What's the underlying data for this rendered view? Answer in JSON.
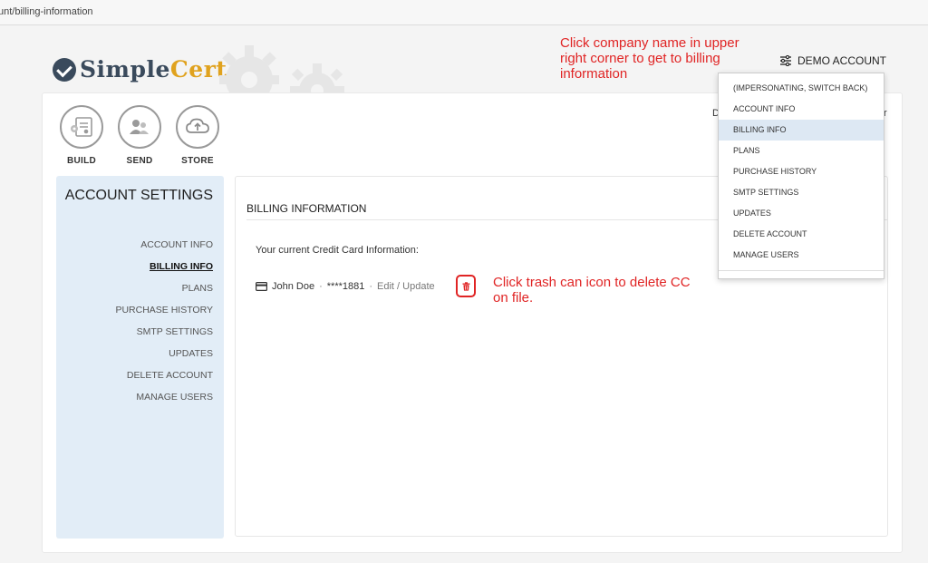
{
  "browser": {
    "url_fragment": "unt/billing-information"
  },
  "brand": {
    "name_part1": "Simple",
    "name_part2": "Cert"
  },
  "annotations": {
    "top": "Click company name in upper right corner to get to billing information",
    "cc": "Click trash can icon to delete CC on file."
  },
  "account_menu": {
    "label": "DEMO ACCOUNT",
    "icon": "sliders-icon",
    "items": [
      {
        "label": "(IMPERSONATING, SWITCH BACK)"
      },
      {
        "label": "ACCOUNT INFO"
      },
      {
        "label": "BILLING INFO"
      },
      {
        "label": "PLANS"
      },
      {
        "label": "PURCHASE HISTORY"
      },
      {
        "label": "SMTP SETTINGS"
      },
      {
        "label": "UPDATES"
      },
      {
        "label": "DELETE ACCOUNT"
      },
      {
        "label": "MANAGE USERS"
      }
    ],
    "active_index": 2
  },
  "nav": {
    "build": {
      "label": "BUILD",
      "icon": "certificate-icon"
    },
    "send": {
      "label": "SEND",
      "icon": "users-send-icon"
    },
    "store": {
      "label": "STORE",
      "icon": "cloud-upload-icon"
    }
  },
  "sidebar": {
    "title": "ACCOUNT SETTINGS",
    "items": [
      {
        "label": "ACCOUNT INFO"
      },
      {
        "label": "BILLING INFO"
      },
      {
        "label": "PLANS"
      },
      {
        "label": "PURCHASE HISTORY"
      },
      {
        "label": "SMTP SETTINGS"
      },
      {
        "label": "UPDATES"
      },
      {
        "label": "DELETE ACCOUNT"
      },
      {
        "label": "MANAGE USERS"
      }
    ],
    "active_index": 1
  },
  "billing": {
    "title": "BILLING INFORMATION",
    "cc_label": "Your current Credit Card Information:",
    "card_holder": "John Doe",
    "separator": "·",
    "card_masked": "****1881",
    "edit_label": "Edit / Update",
    "card_icon": "credit-card-icon",
    "delete_icon": "trash-icon"
  },
  "colors": {
    "annotation": "#e02424",
    "sidebar_bg": "#e2edf7",
    "brand_dark": "#3a4a5c",
    "brand_accent": "#e0a21e",
    "menu_active": "#dde8f3"
  }
}
